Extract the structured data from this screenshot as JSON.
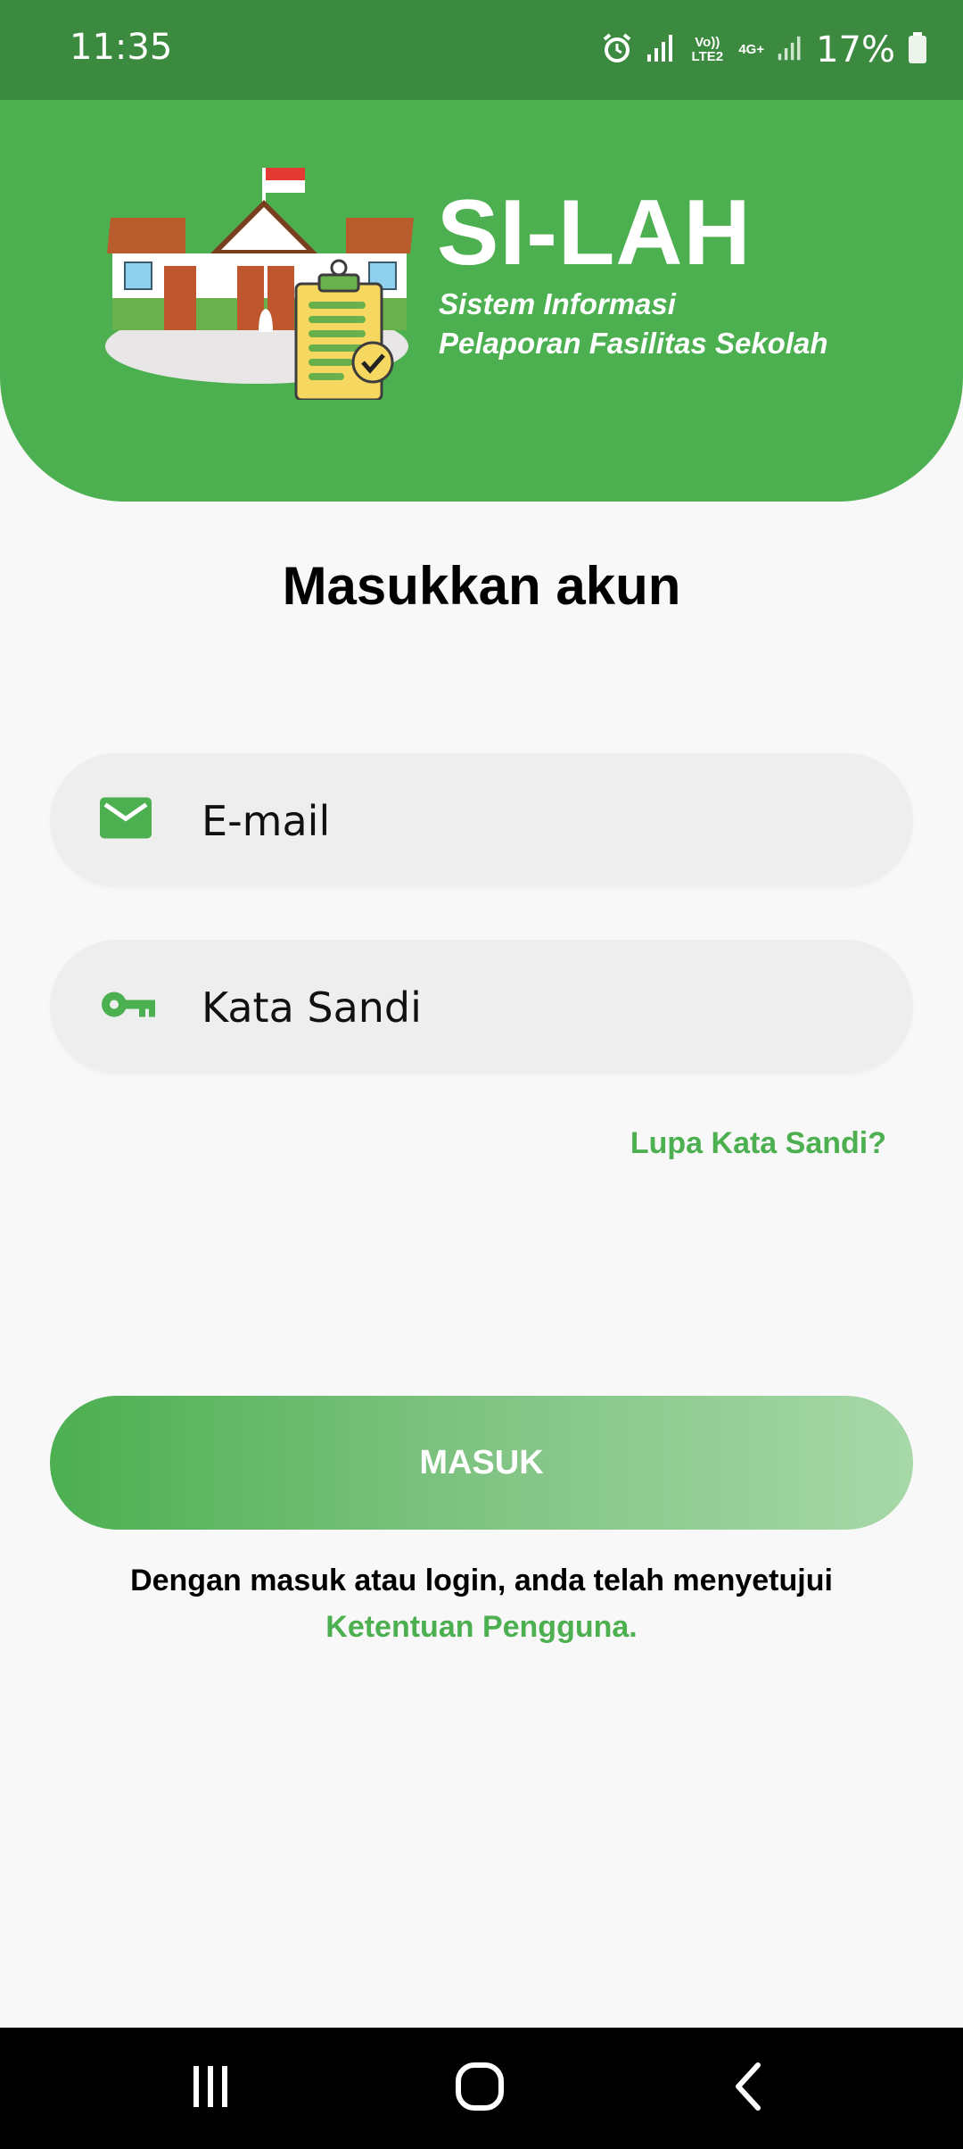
{
  "status_bar": {
    "time": "11:35",
    "network": "Vo)) LTE2",
    "network_type": "4G+",
    "battery": "17%"
  },
  "header": {
    "app_title": "SI-LAH",
    "subtitle_line1": "Sistem Informasi",
    "subtitle_line2": "Pelaporan Fasilitas Sekolah"
  },
  "login": {
    "title": "Masukkan akun",
    "email_placeholder": "E-mail",
    "password_placeholder": "Kata Sandi",
    "forgot_password": "Lupa Kata Sandi?",
    "submit_label": "MASUK",
    "terms_text": "Dengan masuk atau login, anda telah menyetujui",
    "terms_link": "Ketentuan Pengguna."
  },
  "colors": {
    "primary": "#4caf50",
    "status_bar": "#3c8a40",
    "field_bg": "#eeeeee",
    "background": "#f8f8f8"
  },
  "icons": [
    "alarm-icon",
    "signal-icon",
    "battery-icon",
    "mail-icon",
    "key-icon",
    "recents-icon",
    "home-icon",
    "back-icon"
  ]
}
